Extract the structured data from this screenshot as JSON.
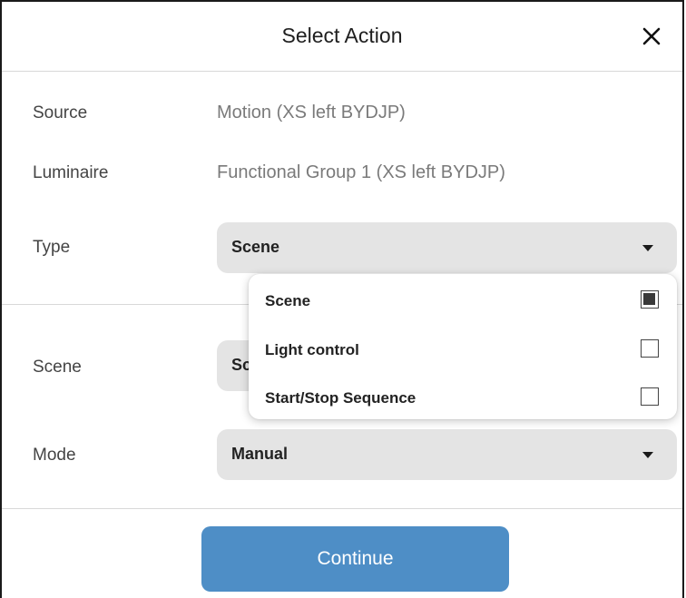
{
  "dialog": {
    "title": "Select Action"
  },
  "fields": {
    "source": {
      "label": "Source",
      "value": "Motion (XS left BYDJP)"
    },
    "luminaire": {
      "label": "Luminaire",
      "value": "Functional Group 1 (XS left BYDJP)"
    },
    "type": {
      "label": "Type",
      "selected": "Scene"
    },
    "scene": {
      "label": "Scene",
      "selected_partial": "Sc"
    },
    "mode": {
      "label": "Mode",
      "selected": "Manual"
    }
  },
  "dropdown": {
    "options": [
      {
        "label": "Scene",
        "checked": true
      },
      {
        "label": "Light control",
        "checked": false
      },
      {
        "label": "Start/Stop Sequence",
        "checked": false
      }
    ]
  },
  "footer": {
    "continue_label": "Continue"
  },
  "colors": {
    "primary_button": "#4e8ec6",
    "select_bg": "#e4e4e4"
  },
  "icons": {
    "close": "close-icon",
    "caret": "chevron-down-icon"
  }
}
